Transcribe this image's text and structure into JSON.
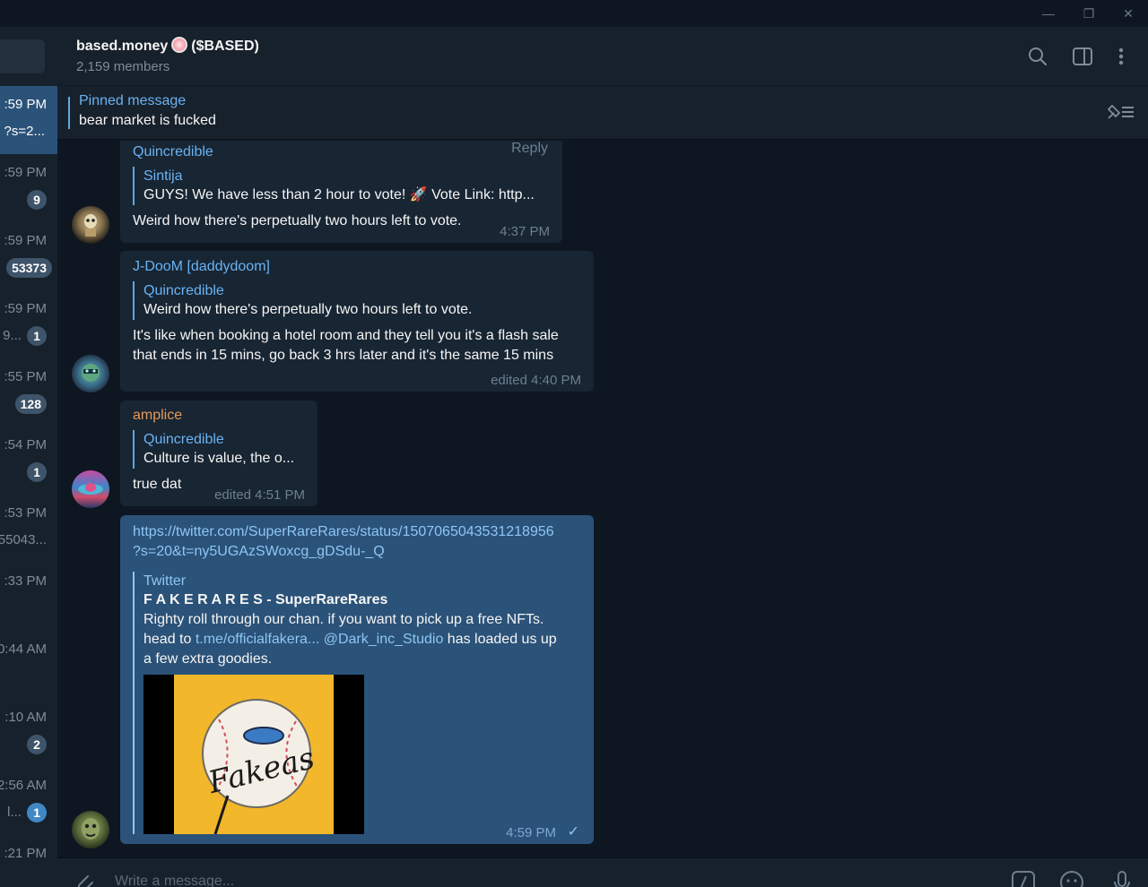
{
  "window": {
    "minimize": "—",
    "restore": "❐",
    "close": "✕"
  },
  "sidebar": {
    "chats": [
      {
        "time": ":59 PM",
        "snippet": "?s=2...",
        "badge": ""
      },
      {
        "time": ":59 PM",
        "snippet": "",
        "badge": "9"
      },
      {
        "time": ":59 PM",
        "snippet": "",
        "badge": "53373"
      },
      {
        "time": ":59 PM",
        "snippet": "9...",
        "badge": "1"
      },
      {
        "time": ":55 PM",
        "snippet": "",
        "badge": "128"
      },
      {
        "time": ":54 PM",
        "snippet": "",
        "badge": "1"
      },
      {
        "time": ":53 PM",
        "snippet": "55043...",
        "badge": ""
      },
      {
        "time": ":33 PM",
        "snippet": "",
        "badge": ""
      },
      {
        "time": "0:44 AM",
        "snippet": "",
        "badge": ""
      },
      {
        "time": ":10 AM",
        "snippet": "",
        "badge": "2"
      },
      {
        "time": "2:56 AM",
        "snippet": "l...",
        "badge": "1"
      },
      {
        "time": ":21 PM",
        "snippet": "",
        "badge": ""
      }
    ]
  },
  "header": {
    "title_prefix": "based.money",
    "title_suffix": "($BASED)",
    "members": "2,159 members"
  },
  "pinned": {
    "label": "Pinned message",
    "text": "bear market is fucked"
  },
  "messages": {
    "m1": {
      "sender": "Quincredible",
      "reply_label": "Reply",
      "quote_name": "Sintija",
      "quote_text": "GUYS! We have less than 2 hour to vote! 🚀  Vote Link: http...",
      "text": "Weird how there's perpetually two hours left to vote.",
      "time": "4:37 PM"
    },
    "m2": {
      "sender": "J-DooM [daddydoom]",
      "quote_name": "Quincredible",
      "quote_text": "Weird how there's perpetually two hours left to vote.",
      "text_line1": "It's like when booking a hotel room and they tell you it's a flash sale",
      "text_line2": "that ends in 15 mins, go back 3 hrs later and it's the same 15 mins",
      "time": "edited 4:40 PM"
    },
    "m3": {
      "sender": "amplice",
      "quote_name": "Quincredible",
      "quote_text": "Culture is value, the o...",
      "text": "true dat",
      "time": "edited 4:51 PM"
    },
    "m4": {
      "url_line1": "https://twitter.com/SuperRareRares/status/1507065043531218956",
      "url_line2": "?s=20&t=ny5UGAzSWoxcg_gDSdu-_Q",
      "site": "Twitter",
      "title": "F A K E R A R E S - SuperRareRares",
      "desc_line1": "Righty roll through our chan. if you want to pick up a free NFTs.",
      "desc_pre": "head to ",
      "desc_link1": "t.me/officialfakera...",
      "desc_link2": "@Dark_inc_Studio",
      "desc_post": " has loaded us up",
      "desc_line3": "a few extra goodies.",
      "image_text": "Fakeas",
      "time": "4:59 PM",
      "check": "✓"
    }
  },
  "composer": {
    "placeholder": "Write a message..."
  },
  "colors": {
    "accent": "#6ab3f3",
    "outgoing": "#2b5278",
    "incoming": "#182533",
    "background": "#0e1621",
    "orange_name": "#e59a59"
  }
}
